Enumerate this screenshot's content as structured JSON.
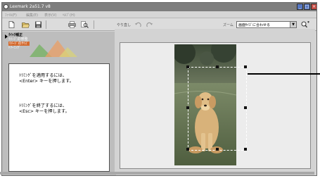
{
  "window": {
    "title": "Lexmark 2a51.7 v8",
    "controls": {
      "minimize": "_",
      "maximize": "□",
      "close": "×"
    }
  },
  "menubar": {
    "items": [
      "ﾌｧｲﾙ(F)",
      "編集(E)",
      "表示(V)",
      "ﾍﾙﾌﾟ(H)"
    ]
  },
  "toolbar": {
    "icons": [
      "new-document-icon",
      "open-folder-icon",
      "save-icon",
      "print-icon",
      "print-preview-icon",
      "undo-icon",
      "redo-icon",
      "zoom-in-icon"
    ],
    "redo_label": "やり直し",
    "zoom_label": "ズーム",
    "zoom_value": "画面ｻｲｽﾞに合わせる"
  },
  "task_nav": {
    "heading": "ｸｲｯｸ補正",
    "items": [
      "ｲﾒｰｼﾞの修整",
      "ｲﾒｰｼﾞのｻｲｽﾞ",
      "ﾄﾘｰﾐﾝｸﾞ"
    ],
    "active_index": 1
  },
  "help": {
    "apply_line1": "ﾄﾘﾐﾝｸﾞを適用するには、",
    "apply_line2": "<Enter> キーを押します。",
    "exit_line1": "ﾄﾘﾐﾝｸﾞを終了するには、",
    "exit_line2": "<Esc> キーを押します。"
  },
  "colors": {
    "accent": "#d46a2e",
    "titlebar": "#7e7e7e",
    "panel": "#bdbdbd"
  }
}
